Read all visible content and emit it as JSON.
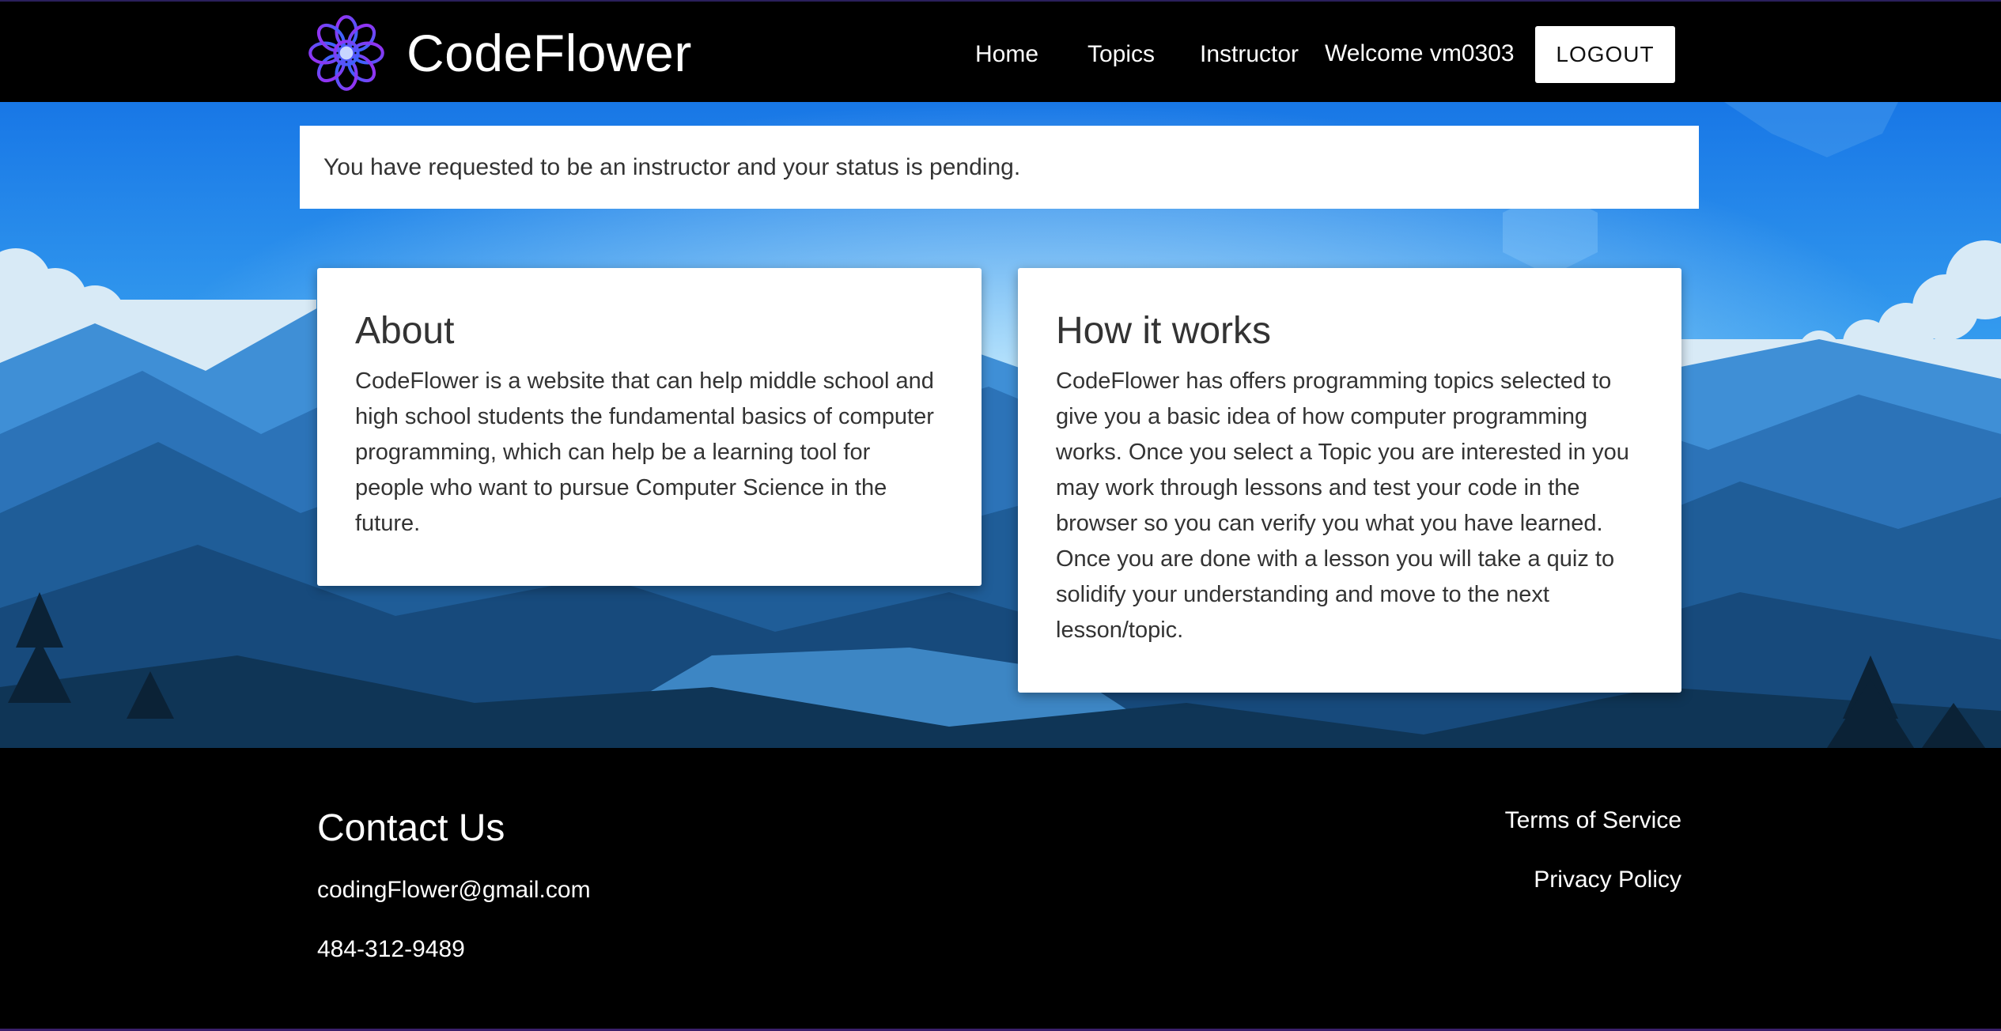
{
  "header": {
    "brand": "CodeFlower",
    "nav": {
      "home": "Home",
      "topics": "Topics",
      "instructor": "Instructor"
    },
    "welcome": "Welcome vm0303",
    "logout": "LOGOUT"
  },
  "alert": {
    "message": "You have requested to be an instructor and your status is pending."
  },
  "cards": {
    "about": {
      "title": "About",
      "body": "CodeFlower is a website that can help middle school and high school students the fundamental basics of computer programming, which can help be a learning tool for people who want to pursue Computer Science in the future."
    },
    "how": {
      "title": "How it works",
      "body": "CodeFlower has offers programming topics selected to give you a basic idea of how computer programming works. Once you select a Topic you are interested in you may work through lessons and test your code in the browser so you can verify you what you have learned. Once you are done with a lesson you will take a quiz to solidify your understanding and move to the next lesson/topic."
    }
  },
  "footer": {
    "contact_title": "Contact Us",
    "email": "codingFlower@gmail.com",
    "phone": "484-312-9489",
    "terms": "Terms of Service",
    "privacy": "Privacy Policy"
  },
  "icons": {
    "logo": "flower-logo-icon"
  },
  "colors": {
    "header_bg": "#000000",
    "sky_top": "#1a73e8",
    "sky_glow": "#7fd0ff",
    "logo_purple": "#8a2be2",
    "logo_blue": "#3b5bff"
  }
}
